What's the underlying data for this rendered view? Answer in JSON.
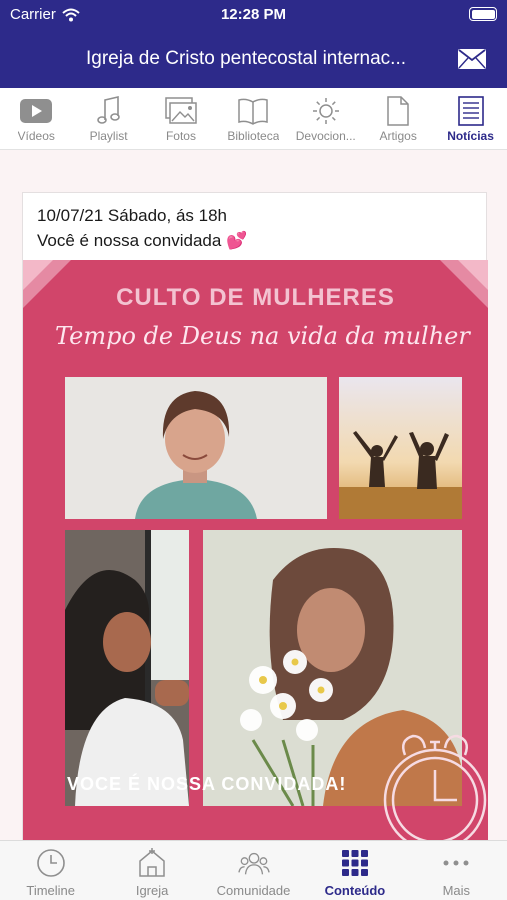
{
  "status_bar": {
    "carrier": "Carrier",
    "time": "12:28 PM"
  },
  "nav": {
    "title": "Igreja de Cristo pentecostal internac..."
  },
  "category_tabs": [
    {
      "label": "Vídeos",
      "icon": "play-icon"
    },
    {
      "label": "Playlist",
      "icon": "music-note-icon"
    },
    {
      "label": "Fotos",
      "icon": "photos-icon"
    },
    {
      "label": "Biblioteca",
      "icon": "book-icon"
    },
    {
      "label": "Devocion...",
      "icon": "sun-icon"
    },
    {
      "label": "Artigos",
      "icon": "document-icon"
    },
    {
      "label": "Notícias",
      "icon": "news-icon",
      "active": true
    }
  ],
  "post": {
    "line1": "10/07/21 Sábado, ás 18h",
    "line2": "Você é nossa convidada 💕",
    "poster": {
      "heading": "CULTO DE MULHERES",
      "subtitle": "Tempo de Deus na vida da mulher",
      "invite": "VOCE É NOSSA CONVIDADA!"
    }
  },
  "bottom_tabs": [
    {
      "label": "Timeline",
      "icon": "clock-icon"
    },
    {
      "label": "Igreja",
      "icon": "church-icon"
    },
    {
      "label": "Comunidade",
      "icon": "community-icon"
    },
    {
      "label": "Conteúdo",
      "icon": "grid-icon",
      "active": true
    },
    {
      "label": "Mais",
      "icon": "more-icon"
    }
  ],
  "colors": {
    "primary": "#2d2a8a",
    "poster_pink": "#d1456a",
    "inactive": "#8a8a8a"
  }
}
